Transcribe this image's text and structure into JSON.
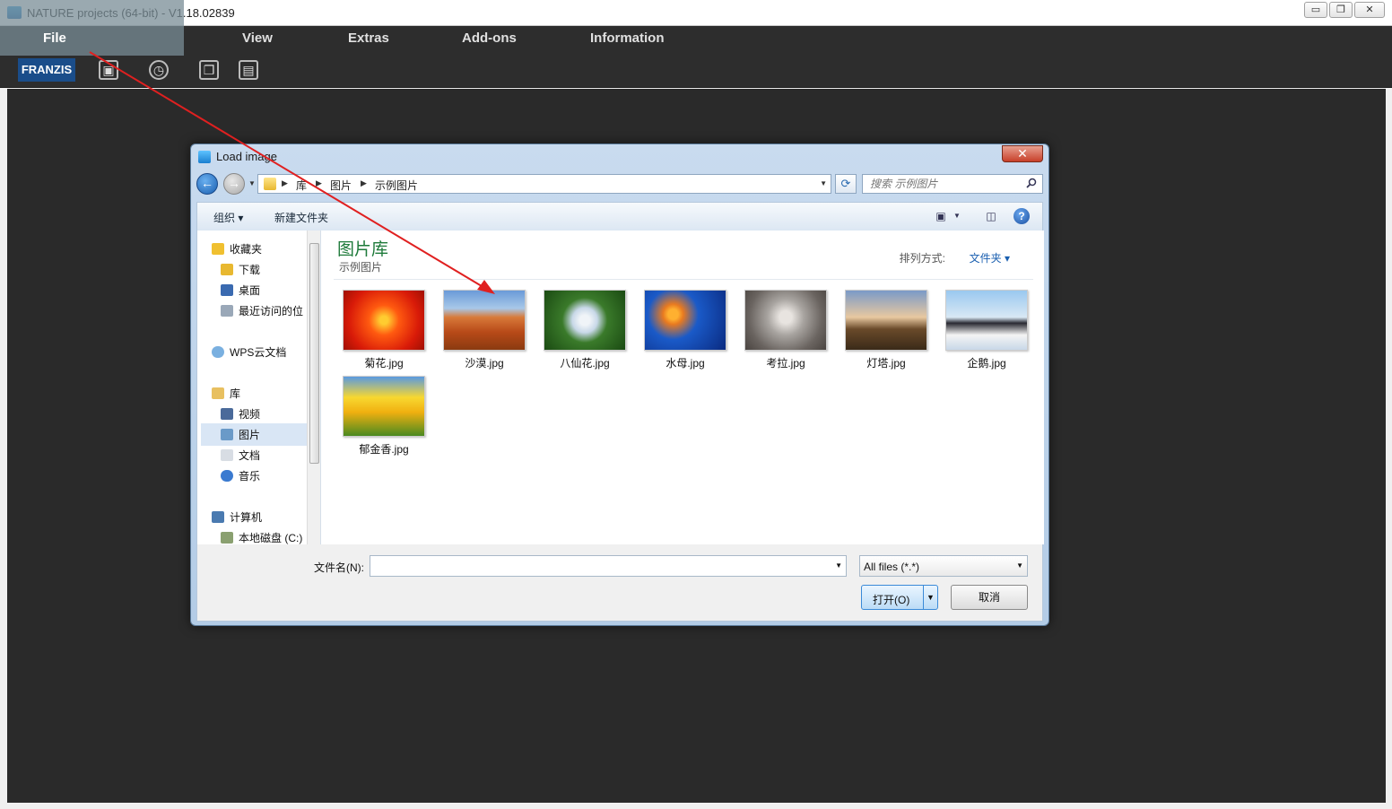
{
  "app": {
    "title": "NATURE projects (64-bit) - V1.18.02839",
    "window_buttons": [
      "▭",
      "❐",
      "✕"
    ],
    "menu": [
      "File",
      "View",
      "Extras",
      "Add-ons",
      "Information"
    ],
    "logo": "FRANZIS"
  },
  "dialog": {
    "title": "Load image",
    "close_label": "✕",
    "breadcrumb": [
      "库",
      "图片",
      "示例图片"
    ],
    "search_placeholder": "搜索 示例图片",
    "commands": [
      "组织 ▾",
      "新建文件夹"
    ],
    "nav": {
      "favorites": "收藏夹",
      "downloads": "下载",
      "desktop": "桌面",
      "recent": "最近访问的位",
      "wps": "WPS云文档",
      "library": "库",
      "videos": "视频",
      "pictures": "图片",
      "documents": "文档",
      "music": "音乐",
      "computer": "计算机",
      "local_disk": "本地磁盘 (C:)"
    },
    "library_title": "图片库",
    "library_subtitle": "示例图片",
    "sort_label": "排列方式:",
    "sort_value": "文件夹 ▾",
    "files": [
      "菊花.jpg",
      "沙漠.jpg",
      "八仙花.jpg",
      "水母.jpg",
      "考拉.jpg",
      "灯塔.jpg",
      "企鹅.jpg",
      "郁金香.jpg"
    ],
    "filename_label": "文件名(N):",
    "filename_value": "",
    "filter_value": "All files (*.*)",
    "open_label": "打开(O)",
    "cancel_label": "取消"
  }
}
